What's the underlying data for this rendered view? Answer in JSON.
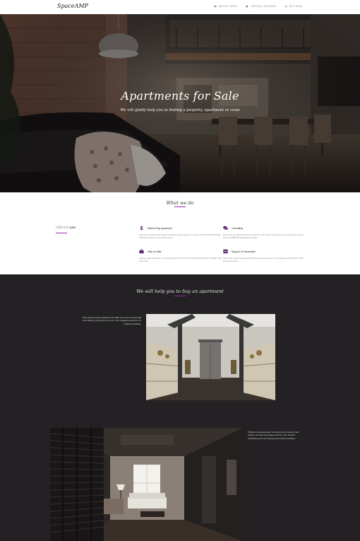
{
  "header": {
    "logo": "SpaceAMP",
    "nav": [
      {
        "label": "WATCH VIDEO",
        "icon": "video-icon"
      },
      {
        "label": "VIEW ALL DESIGNS",
        "icon": "tag-icon"
      },
      {
        "label": "BUY NOW",
        "icon": "cart-icon"
      }
    ]
  },
  "hero": {
    "title": "Apartments for Sale",
    "subtitle": "We will gladly help you in finding a property, apartment or room"
  },
  "what_we_do": {
    "title": "What we do",
    "tabs": [
      "Offered",
      "sale"
    ],
    "features": [
      {
        "icon": "dollar-icon",
        "title": "Want to Buy Apartment",
        "text": "Want to buy and rent real estate? Choosing a right property for renting. Your AMP Rental Website Template answers to your real questions."
      },
      {
        "icon": "chat-icon",
        "title": "Consulting",
        "text": "How to pick an apartment? When should the end tenant? These and more questions are easy to find in our AMP Rental Website Template."
      },
      {
        "icon": "briefcase-icon",
        "title": "Help on Sale",
        "text": "Need a quality assistance in choosing a flat to buy? Go to the AMP Rental Website Template to get some help."
      },
      {
        "icon": "handshake-icon",
        "title": "Support of Transaction",
        "text": "We provide a guide for escape through experts to assist you in managing your transaction while buying a property."
      }
    ]
  },
  "help": {
    "title": "We will help you to buy an apartment",
    "paragraph1": "Web pages and ads published in the AMP open source format load near instantly, giving users a smooth, more engaging experience on mobile and desktop.",
    "paragraph2": "Publishers and advertisers can decide how to present their content, and what technology vendors to use, all while maintaining and improving key performance indicators."
  },
  "colors": {
    "accent": "#9b27b0",
    "dark_bg": "#232123",
    "white": "#ffffff"
  }
}
